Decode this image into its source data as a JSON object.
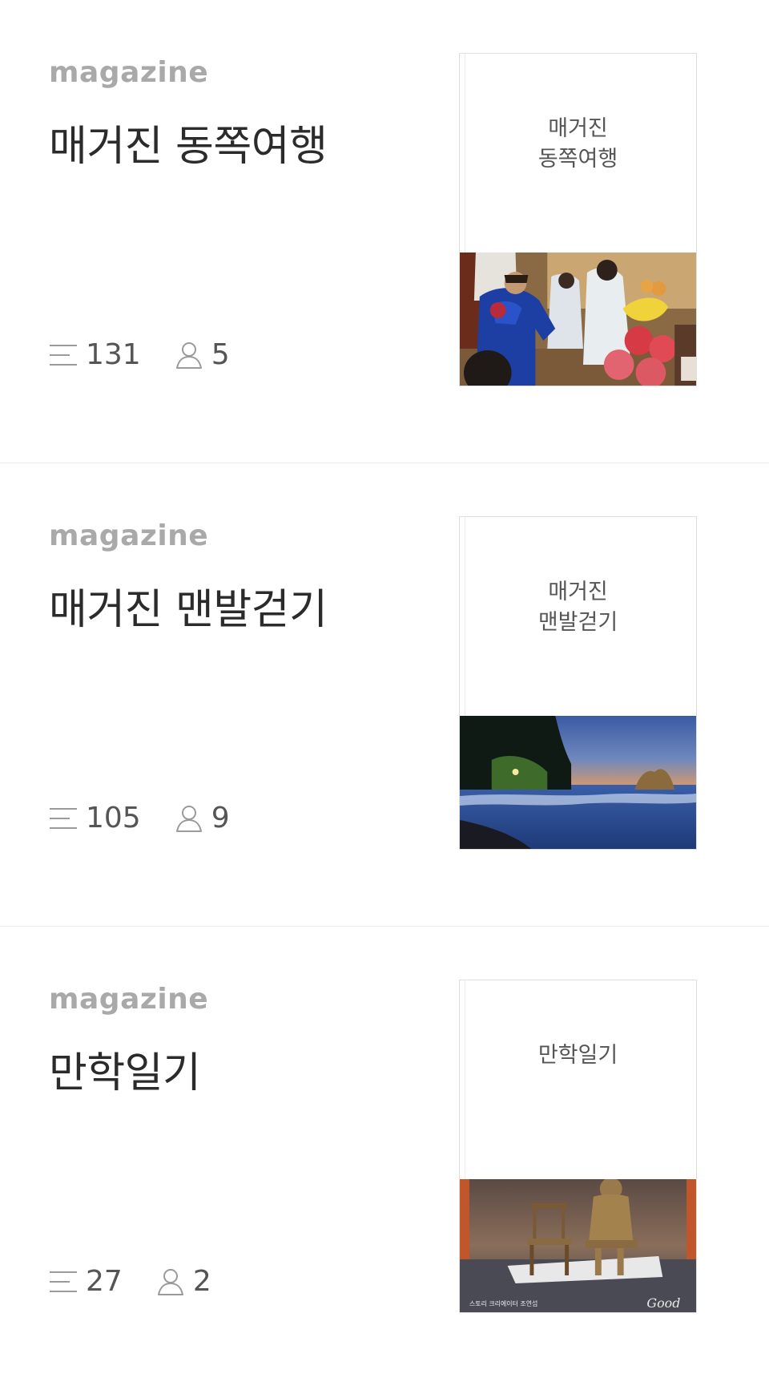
{
  "magazines": [
    {
      "kicker": "magazine",
      "title": "매거진 동쪽여행",
      "cover_lines": [
        "매거진",
        "동쪽여행"
      ],
      "article_count": "131",
      "subscriber_count": "5",
      "cover_image": "ritual-ceremony-photo"
    },
    {
      "kicker": "magazine",
      "title": "매거진 맨발걷기",
      "cover_lines": [
        "매거진",
        "맨발걷기"
      ],
      "article_count": "105",
      "subscriber_count": "9",
      "cover_image": "night-beach-photo"
    },
    {
      "kicker": "magazine",
      "title": "만학일기",
      "cover_lines": [
        "만학일기"
      ],
      "article_count": "27",
      "subscriber_count": "2",
      "cover_image": "statue-chair-photo",
      "cover_caption": "스토리 크리에이터 조연섭",
      "cover_signature": "Good"
    }
  ],
  "icons": {
    "articles": "list-lines-icon",
    "subscribers": "person-outline-icon"
  }
}
